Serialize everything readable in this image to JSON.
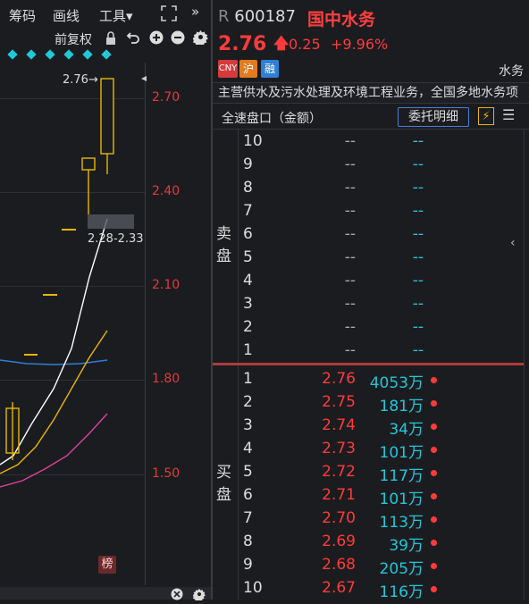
{
  "chart_toolbar": {
    "items": [
      "筹码",
      "画线",
      "工具▾"
    ],
    "expand_icon": "expand-icon",
    "more_icon": "»"
  },
  "chart_subbar": {
    "adjust_label": "前复权",
    "icons": [
      "lock-icon",
      "undo-icon",
      "zoom-in-icon",
      "zoom-out-icon",
      "gear-icon"
    ]
  },
  "chart": {
    "price_ticks": [
      "2.70",
      "2.40",
      "2.10",
      "1.80",
      "1.50"
    ],
    "high_label": "2.76→",
    "range_label": "2.28-2.33",
    "rank_label": "榜"
  },
  "quote": {
    "market_prefix": "R",
    "code": "600187",
    "name": "国中水务",
    "price": "2.76",
    "change": "0.25",
    "change_pct": "+9.96%",
    "tags": [
      "CNY",
      "沪",
      "融"
    ],
    "sector_label": "水务",
    "business_desc": "主营供水及污水处理及环境工程业务，全国多地水务项"
  },
  "order_book": {
    "title": "全速盘口（金额）",
    "detail_button": "委托明细",
    "sell_label": "卖盘",
    "buy_label": "买盘",
    "sell_rows": [
      {
        "level": "10",
        "price": "--",
        "vol": "--"
      },
      {
        "level": "9",
        "price": "--",
        "vol": "--"
      },
      {
        "level": "8",
        "price": "--",
        "vol": "--"
      },
      {
        "level": "7",
        "price": "--",
        "vol": "--"
      },
      {
        "level": "6",
        "price": "--",
        "vol": "--"
      },
      {
        "level": "5",
        "price": "--",
        "vol": "--"
      },
      {
        "level": "4",
        "price": "--",
        "vol": "--"
      },
      {
        "level": "3",
        "price": "--",
        "vol": "--"
      },
      {
        "level": "2",
        "price": "--",
        "vol": "--"
      },
      {
        "level": "1",
        "price": "--",
        "vol": "--"
      }
    ],
    "buy_rows": [
      {
        "level": "1",
        "price": "2.76",
        "vol": "4053万"
      },
      {
        "level": "2",
        "price": "2.75",
        "vol": "181万"
      },
      {
        "level": "3",
        "price": "2.74",
        "vol": "34万"
      },
      {
        "level": "4",
        "price": "2.73",
        "vol": "101万"
      },
      {
        "level": "5",
        "price": "2.72",
        "vol": "117万"
      },
      {
        "level": "6",
        "price": "2.71",
        "vol": "101万"
      },
      {
        "level": "7",
        "price": "2.70",
        "vol": "113万"
      },
      {
        "level": "8",
        "price": "2.69",
        "vol": "39万"
      },
      {
        "level": "9",
        "price": "2.68",
        "vol": "205万"
      },
      {
        "level": "10",
        "price": "2.67",
        "vol": "116万"
      }
    ]
  },
  "colors": {
    "up": "#ff3b3b",
    "vol": "#20c8d8",
    "candle": "#e6b800",
    "ma_white": "#ffffff",
    "ma_yellow": "#e6b800",
    "ma_pink": "#e040a0",
    "ma_blue": "#2f7fd6"
  }
}
